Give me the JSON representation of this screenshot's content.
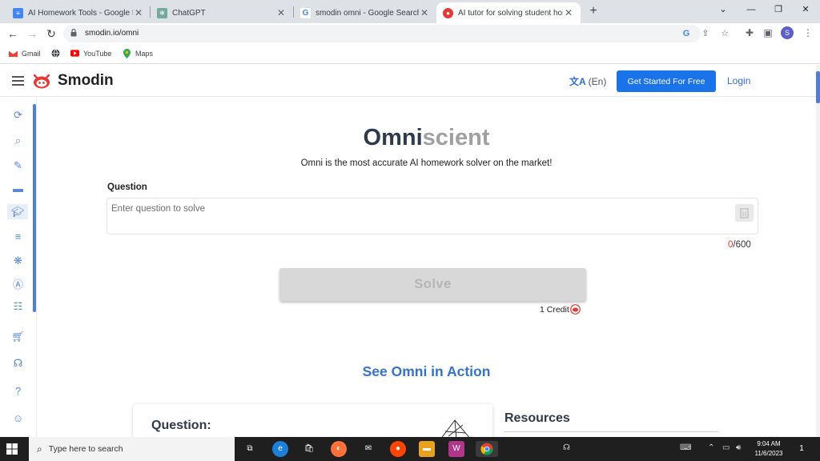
{
  "browser": {
    "tabs": [
      {
        "title": "AI Homework Tools - Google Do",
        "favicon": "google-docs-icon",
        "color": "#4285f4",
        "active": false
      },
      {
        "title": "ChatGPT",
        "favicon": "chatgpt-icon",
        "color": "#74aa9c",
        "active": false
      },
      {
        "title": "smodin omni - Google Search",
        "favicon": "google-icon",
        "color": "#4285f4",
        "active": false
      },
      {
        "title": "AI tutor for solving student hom",
        "favicon": "smodin-icon",
        "color": "#e53935",
        "active": true
      }
    ],
    "url": "smodin.io/omni",
    "bookmarks": [
      {
        "label": "Gmail",
        "icon": "gmail-icon"
      },
      {
        "label": "",
        "icon": "globe-icon"
      },
      {
        "label": "YouTube",
        "icon": "youtube-icon"
      },
      {
        "label": "Maps",
        "icon": "maps-icon"
      }
    ],
    "profile_initial": "S"
  },
  "site": {
    "brand": "Smodin",
    "brand_color": "#e53935",
    "language": "(En)",
    "get_started": "Get Started For Free",
    "login": "Login",
    "accent": "#1a73e8"
  },
  "sidebar": {
    "icons": [
      "rewriter-icon",
      "plagiarism-icon",
      "pen-icon",
      "chat-icon",
      "graduation-cap-icon",
      "text-lines-icon",
      "brain-icon",
      "grader-icon",
      "list-add-icon",
      "cart-icon",
      "headset-icon",
      "help-icon",
      "account-icon"
    ]
  },
  "main": {
    "title_part1": "Omni",
    "title_part2": "scient",
    "subtitle": "Omni is the most accurate AI homework solver on the market!",
    "question_label": "Question",
    "question_placeholder": "Enter question to solve",
    "char_count": "0",
    "char_limit": "/600",
    "solve_button": "Solve",
    "credit_text": "1 Credit",
    "see_omni": "See Omni in Action",
    "example_question_heading": "Question:",
    "resources_heading": "Resources"
  },
  "taskbar": {
    "search_placeholder": "Type here to search",
    "time": "9:04 AM",
    "date": "11/6/2023",
    "notification_count": "1"
  }
}
